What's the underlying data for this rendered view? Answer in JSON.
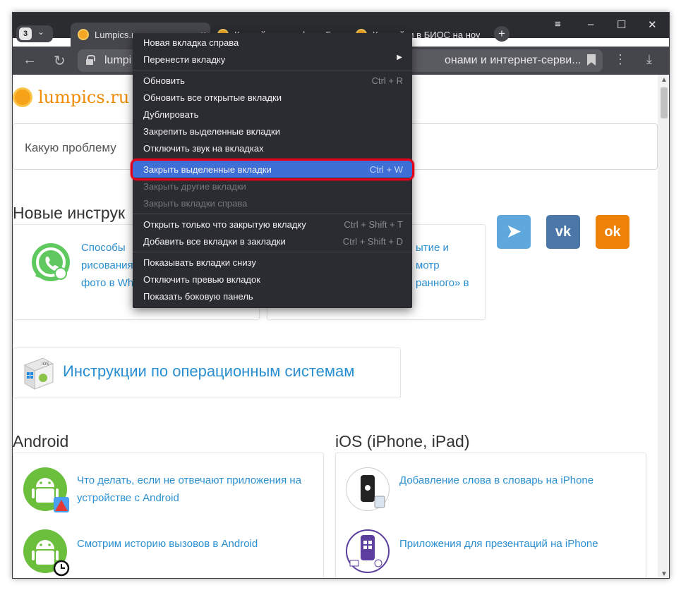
{
  "browser": {
    "tab_count": "3",
    "tabs": [
      {
        "label": "Lumpics.r",
        "close": "×"
      },
      {
        "label": "Как зайти в профиль Б",
        "close": ""
      },
      {
        "label": "Как войти в БИОС на ноу",
        "close": ""
      }
    ],
    "new_tab": "+",
    "window_controls": {
      "menu": "≡",
      "minimize": "–",
      "maximize": "☐",
      "close": "✕"
    },
    "nav": {
      "back": "←",
      "reload": "↻"
    },
    "address": {
      "url_left": "lumpi",
      "url_right": "онами и интернет-серви..."
    },
    "toolbar_icons": [
      "bookmark-icon",
      "more-icon",
      "download-icon"
    ]
  },
  "page": {
    "logo_text": "lumpics.ru",
    "search_placeholder": "Какую проблему",
    "new_section_title": "Новые инструк",
    "card1_lines": [
      "Способы",
      "рисования",
      "фото в Wh"
    ],
    "card2_lines": [
      "ытие и",
      "мотр",
      "ранного» в"
    ],
    "os_section_title": "Инструкции по операционным системам",
    "android_title": "Android",
    "ios_title": "iOS (iPhone, iPad)",
    "android_items": [
      {
        "line1": "Что делать, если не отвечают приложения на",
        "line2": "устройстве с Android"
      },
      {
        "line1": "Смотрим историю вызовов в Android",
        "line2": ""
      }
    ],
    "ios_items": [
      {
        "line1": "Добавление слова в словарь на iPhone"
      },
      {
        "line1": "Приложения для презентаций на iPhone"
      }
    ]
  },
  "social": [
    {
      "name": "telegram",
      "color": "#5ea8dd",
      "glyph": "➤"
    },
    {
      "name": "vk",
      "color": "#4a76a8",
      "glyph": "vk"
    },
    {
      "name": "ok",
      "color": "#ee8208",
      "glyph": "ok"
    }
  ],
  "context_menu": {
    "items": [
      {
        "label": "Новая вкладка справа",
        "shortcut": ""
      },
      {
        "label": "Перенести вкладку",
        "shortcut": ""
      },
      {
        "label": "Обновить",
        "shortcut": "Ctrl + R"
      },
      {
        "label": "Обновить все открытые вкладки",
        "shortcut": ""
      },
      {
        "label": "Дублировать",
        "shortcut": ""
      },
      {
        "label": "Закрепить выделенные вкладки",
        "shortcut": ""
      },
      {
        "label": "Отключить звук на вкладках",
        "shortcut": ""
      },
      {
        "label": "Закрыть выделенные вкладки",
        "shortcut": "Ctrl + W"
      },
      {
        "label": "Закрыть другие вкладки",
        "shortcut": ""
      },
      {
        "label": "Закрыть вкладки справа",
        "shortcut": ""
      },
      {
        "label": "Открыть только что закрытую вкладку",
        "shortcut": "Ctrl + Shift + T"
      },
      {
        "label": "Добавить все вкладки в закладки",
        "shortcut": "Ctrl + Shift + D"
      },
      {
        "label": "Показывать вкладки снизу",
        "shortcut": ""
      },
      {
        "label": "Отключить превью вкладок",
        "shortcut": ""
      },
      {
        "label": "Показать боковую панель",
        "shortcut": ""
      }
    ],
    "submenu_arrow": "▶",
    "highlighted_item": "Закрыть выделенные вкладки",
    "highlight_color": "#3e6fd6",
    "annotation_color": "#e3001b"
  }
}
